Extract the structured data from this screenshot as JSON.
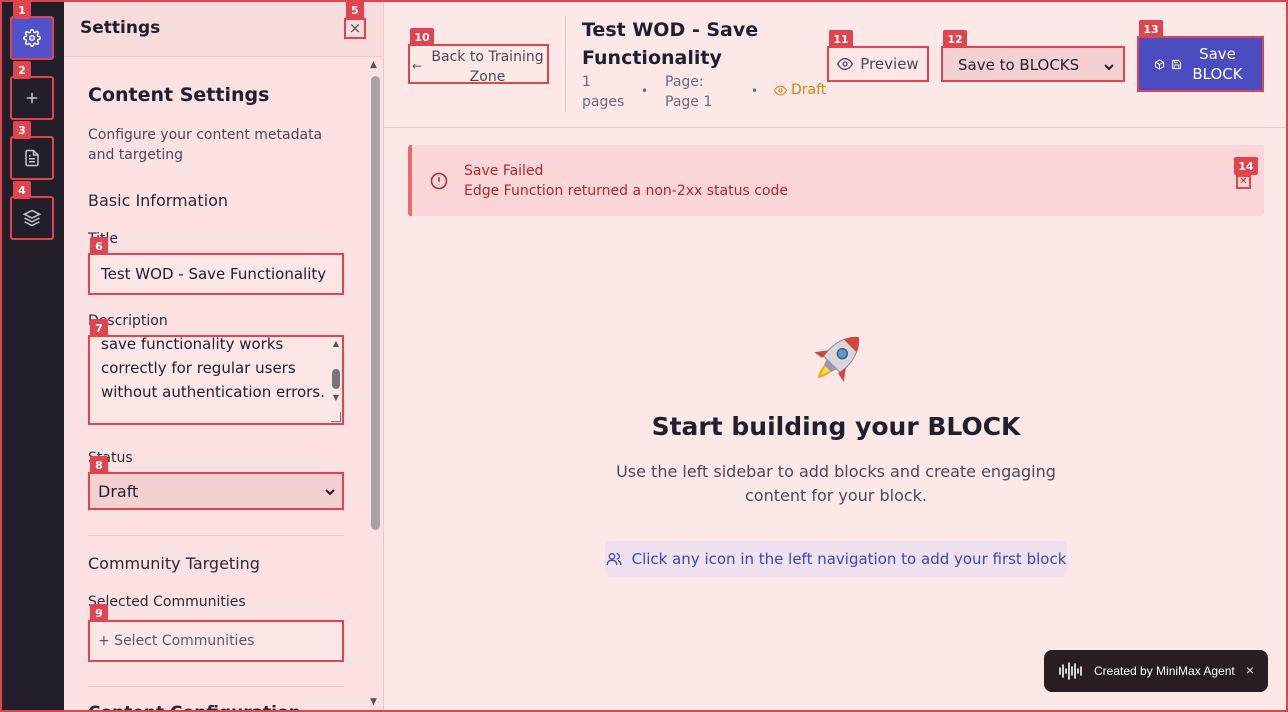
{
  "markers": [
    "1",
    "2",
    "3",
    "4",
    "5",
    "6",
    "7",
    "8",
    "9",
    "10",
    "11",
    "12",
    "13",
    "14"
  ],
  "rail": {
    "items": [
      {
        "name": "settings",
        "icon": "gear-icon",
        "active": true
      },
      {
        "name": "add",
        "icon": "plus-icon",
        "active": false
      },
      {
        "name": "pages",
        "icon": "document-icon",
        "active": false
      },
      {
        "name": "layers",
        "icon": "layers-icon",
        "active": false
      }
    ]
  },
  "panel": {
    "title": "Settings",
    "close_label": "×",
    "section_title": "Content Settings",
    "section_desc": "Configure your content metadata and targeting",
    "basic_info": "Basic Information",
    "title_label": "Title",
    "title_value": "Test WOD - Save Functionality",
    "description_label": "Description",
    "description_value": "save functionality works correctly for regular users without authentication errors.",
    "status_label": "Status",
    "status_value": "Draft",
    "community_targeting": "Community Targeting",
    "selected_communities_label": "Selected Communities",
    "select_communities": "+ Select Communities",
    "content_configuration": "Content Configuration"
  },
  "topbar": {
    "back_label": "Back to Training Zone",
    "doc_title": "Test WOD - Save Functionality",
    "pages_count": "1 pages",
    "page_label": "Page: Page 1",
    "status": "Draft",
    "preview_label": "Preview",
    "save_target": "Save to BLOCKS",
    "save_block_label": "Save BLOCK"
  },
  "alert": {
    "title": "Save Failed",
    "message": "Edge Function returned a non-2xx status code"
  },
  "empty_state": {
    "title": "Start building your BLOCK",
    "description": "Use the left sidebar to add blocks and create engaging content for your block.",
    "hint": "Click any icon in the left navigation to add your first block"
  },
  "toast": {
    "label": "Created by MiniMax Agent",
    "close": "×"
  },
  "colors": {
    "accent": "#4f52c9",
    "annotation": "#e0454f",
    "draft": "#d4870e",
    "error": "#b3262d"
  }
}
